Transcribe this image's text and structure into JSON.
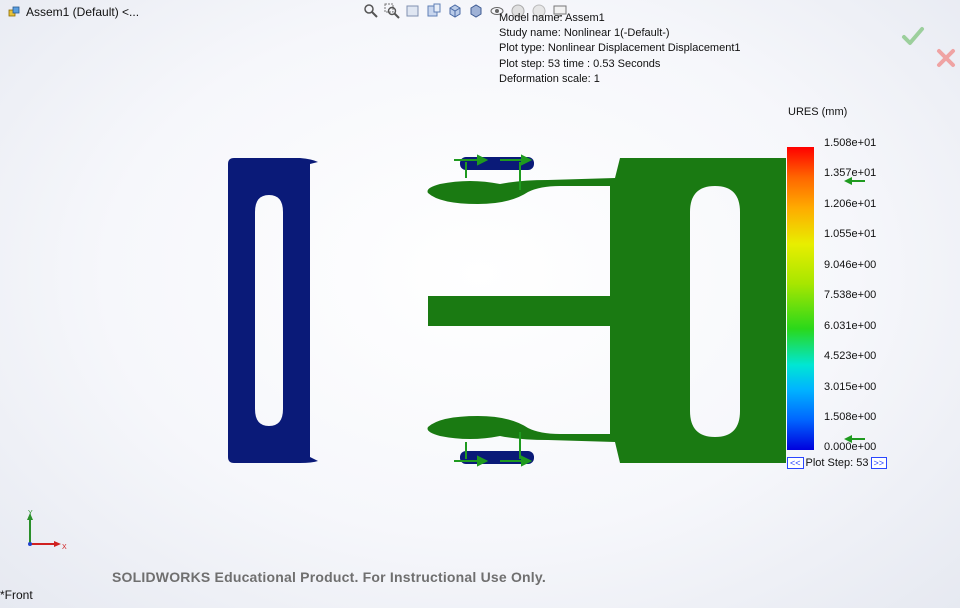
{
  "window": {
    "doc_title": "Assem1 (Default) <...",
    "view_name": "*Front"
  },
  "toolbar": {
    "icons": [
      "zoom-to-fit-icon",
      "zoom-to-area-icon",
      "previous-view-icon",
      "section-view-icon",
      "view-orientation-icon",
      "display-style-icon",
      "hide-show-icon",
      "edit-appearance-icon",
      "apply-scene-icon",
      "view-settings-icon"
    ]
  },
  "plot_info": {
    "model_name": "Model name: Assem1",
    "study_name": "Study name: Nonlinear 1(-Default-)",
    "plot_type": "Plot type: Nonlinear Displacement Displacement1",
    "plot_step": "Plot step: 53   time : 0.53 Seconds",
    "deformation_scale": "Deformation scale: 1"
  },
  "legend": {
    "title": "URES (mm)",
    "values": [
      "1.508e+01",
      "1.357e+01",
      "1.206e+01",
      "1.055e+01",
      "9.046e+00",
      "7.538e+00",
      "6.031e+00",
      "4.523e+00",
      "3.015e+00",
      "1.508e+00",
      "0.000e+00"
    ]
  },
  "plot_step_control": {
    "prev": "<<",
    "label": "Plot Step: 53",
    "next": ">>"
  },
  "watermark": "SOLIDWORKS Educational Product. For Instructional Use Only.",
  "triad": {
    "y": "Y",
    "x": "X"
  },
  "colors": {
    "low": "#0a1a78",
    "mid": "#1a7a12",
    "arrow": "#1f9a1f",
    "cancel": "#e04040",
    "ok": "#3aa83a"
  }
}
